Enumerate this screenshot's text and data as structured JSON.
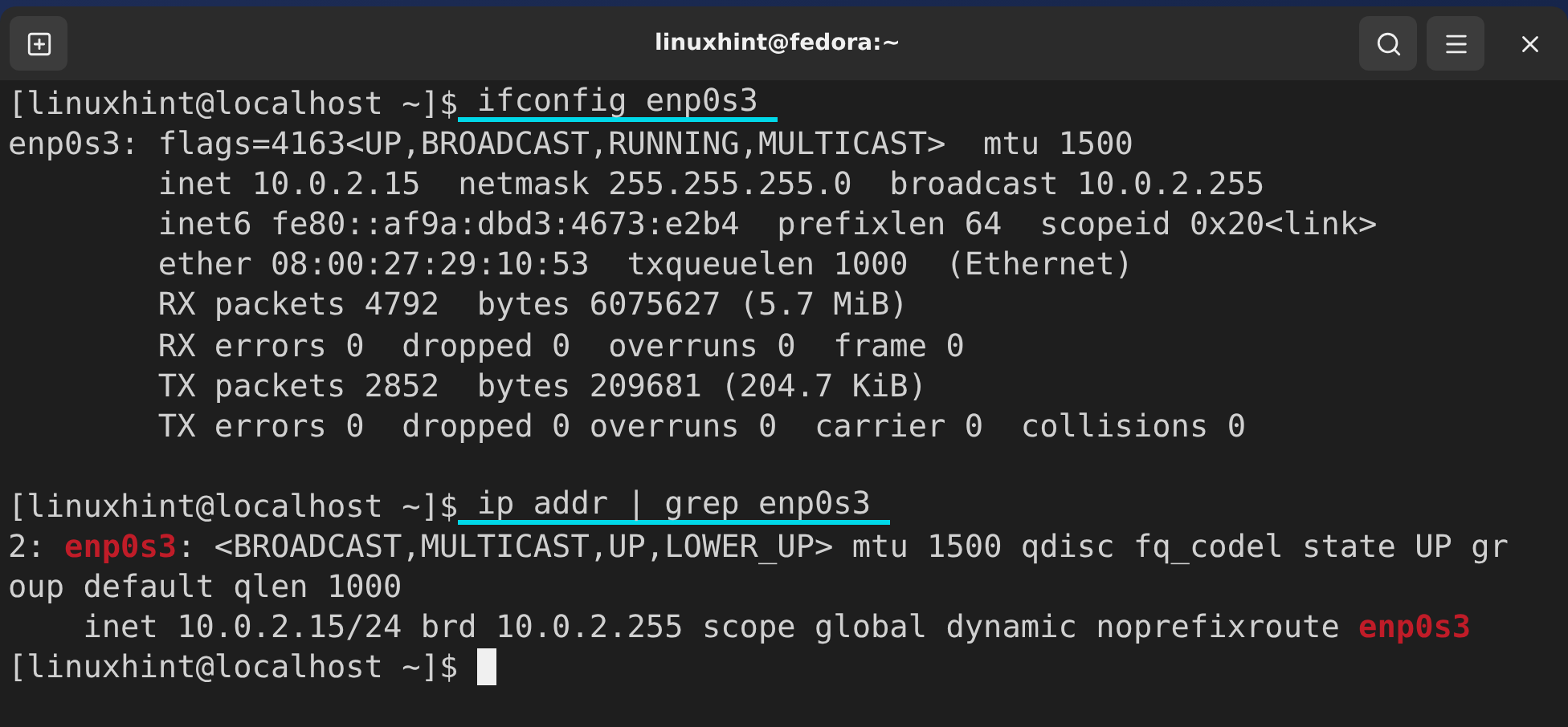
{
  "window": {
    "title": "linuxhint@fedora:~"
  },
  "terminal": {
    "lines": [
      {
        "kind": "text",
        "segments": [
          {
            "kind": "prompt",
            "text": "[linuxhint@localhost ~]$"
          },
          {
            "kind": "command",
            "text": " ifconfig enp0s3"
          }
        ]
      },
      {
        "kind": "text",
        "segments": [
          {
            "kind": "plain",
            "text": "enp0s3: flags=4163<UP,BROADCAST,RUNNING,MULTICAST>  mtu 1500"
          }
        ]
      },
      {
        "kind": "text",
        "segments": [
          {
            "kind": "plain",
            "text": "        inet 10.0.2.15  netmask 255.255.255.0  broadcast 10.0.2.255"
          }
        ]
      },
      {
        "kind": "text",
        "segments": [
          {
            "kind": "plain",
            "text": "        inet6 fe80::af9a:dbd3:4673:e2b4  prefixlen 64  scopeid 0x20<link>"
          }
        ]
      },
      {
        "kind": "text",
        "segments": [
          {
            "kind": "plain",
            "text": "        ether 08:00:27:29:10:53  txqueuelen 1000  (Ethernet)"
          }
        ]
      },
      {
        "kind": "text",
        "segments": [
          {
            "kind": "plain",
            "text": "        RX packets 4792  bytes 6075627 (5.7 MiB)"
          }
        ]
      },
      {
        "kind": "text",
        "segments": [
          {
            "kind": "plain",
            "text": "        RX errors 0  dropped 0  overruns 0  frame 0"
          }
        ]
      },
      {
        "kind": "text",
        "segments": [
          {
            "kind": "plain",
            "text": "        TX packets 2852  bytes 209681 (204.7 KiB)"
          }
        ]
      },
      {
        "kind": "text",
        "segments": [
          {
            "kind": "plain",
            "text": "        TX errors 0  dropped 0 overruns 0  carrier 0  collisions 0"
          }
        ]
      },
      {
        "kind": "blank"
      },
      {
        "kind": "text",
        "segments": [
          {
            "kind": "prompt",
            "text": "[linuxhint@localhost ~]$"
          },
          {
            "kind": "command",
            "text": " ip addr | grep enp0s3"
          }
        ]
      },
      {
        "kind": "text",
        "segments": [
          {
            "kind": "plain",
            "text": "2: "
          },
          {
            "kind": "match",
            "text": "enp0s3"
          },
          {
            "kind": "plain",
            "text": ": <BROADCAST,MULTICAST,UP,LOWER_UP> mtu 1500 qdisc fq_codel state UP gr"
          }
        ]
      },
      {
        "kind": "text",
        "segments": [
          {
            "kind": "plain",
            "text": "oup default qlen 1000"
          }
        ]
      },
      {
        "kind": "text",
        "segments": [
          {
            "kind": "plain",
            "text": "    inet 10.0.2.15/24 brd 10.0.2.255 scope global dynamic noprefixroute "
          },
          {
            "kind": "match",
            "text": "enp0s3"
          }
        ]
      },
      {
        "kind": "cursor",
        "segments": [
          {
            "kind": "prompt",
            "text": "[linuxhint@localhost ~]$ "
          }
        ]
      }
    ]
  }
}
